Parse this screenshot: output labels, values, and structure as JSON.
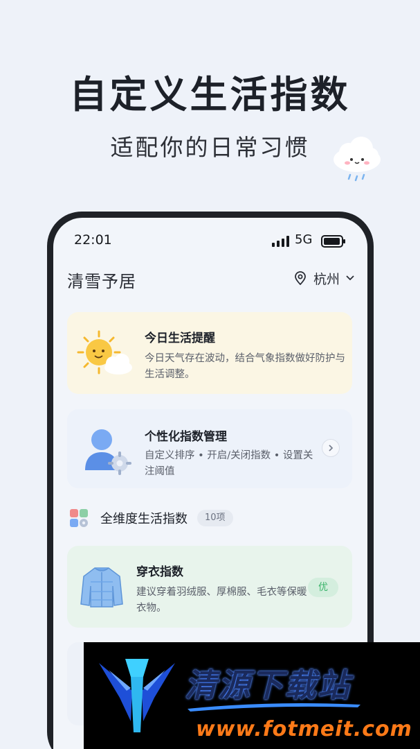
{
  "hero": {
    "title": "自定义生活指数",
    "subtitle": "适配你的日常习惯"
  },
  "status_bar": {
    "time": "22:01",
    "network": "5G"
  },
  "app": {
    "title": "清雪予居",
    "location": "杭州"
  },
  "reminder_card": {
    "title": "今日生活提醒",
    "description": "今日天气存在波动，结合气象指数做好防护与生活调整。"
  },
  "manage_card": {
    "title": "个性化指数管理",
    "description": "自定义排序 • 开启/关闭指数 • 设置关注阈值"
  },
  "section": {
    "title": "全维度生活指数",
    "count": "10项"
  },
  "clothing_card": {
    "title": "穿衣指数",
    "description": "建议穿着羽绒服、厚棉服、毛衣等保暖衣物。",
    "rating": "优"
  },
  "watermark": {
    "title": "清源下载站",
    "url": "www.fotmeit.com"
  },
  "colors": {
    "background": "#eef2f9",
    "reminder_card": "#fbf6e4",
    "manage_card": "#edf2fa",
    "clothing_card": "#e8f4ec",
    "rating_text": "#3bb46b",
    "watermark_url": "#ff7a18"
  },
  "icons": [
    "cloud-mascot-icon",
    "signal-icon",
    "battery-icon",
    "location-pin-icon",
    "chevron-down-icon",
    "sun-cloud-icon",
    "user-gear-icon",
    "chevron-right-icon",
    "grid-icon",
    "jacket-icon",
    "watermark-logo"
  ]
}
